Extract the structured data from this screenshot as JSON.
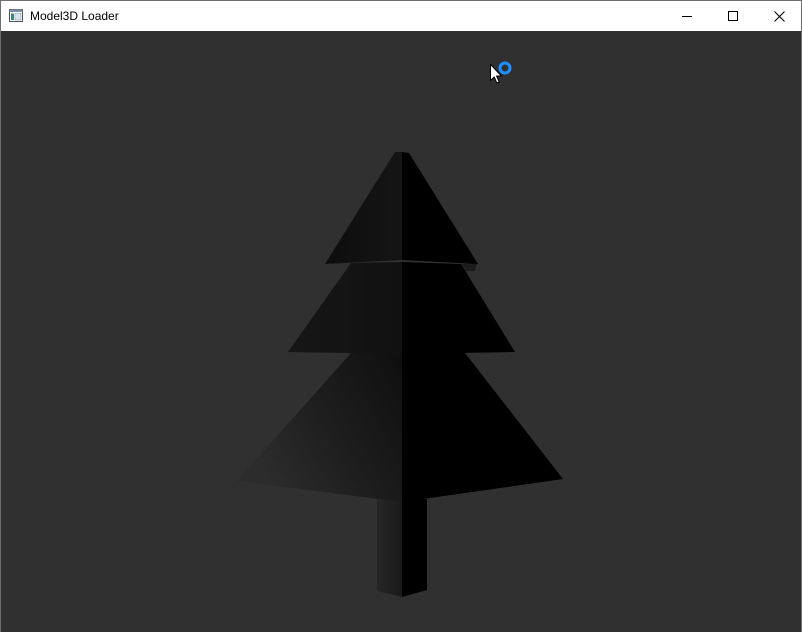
{
  "window": {
    "title": "Model3D Loader",
    "app_icon": "window-app-icon"
  },
  "caption_buttons": {
    "minimize_icon": "minimize-icon",
    "maximize_icon": "maximize-icon",
    "close_icon": "close-icon"
  },
  "viewport": {
    "background_color": "#303030",
    "model": "tree-model",
    "cursor_icon": "arrow-cursor-icon",
    "busy_indicator_icon": "busy-ring-icon",
    "busy_indicator_color": "#1e90ff"
  }
}
